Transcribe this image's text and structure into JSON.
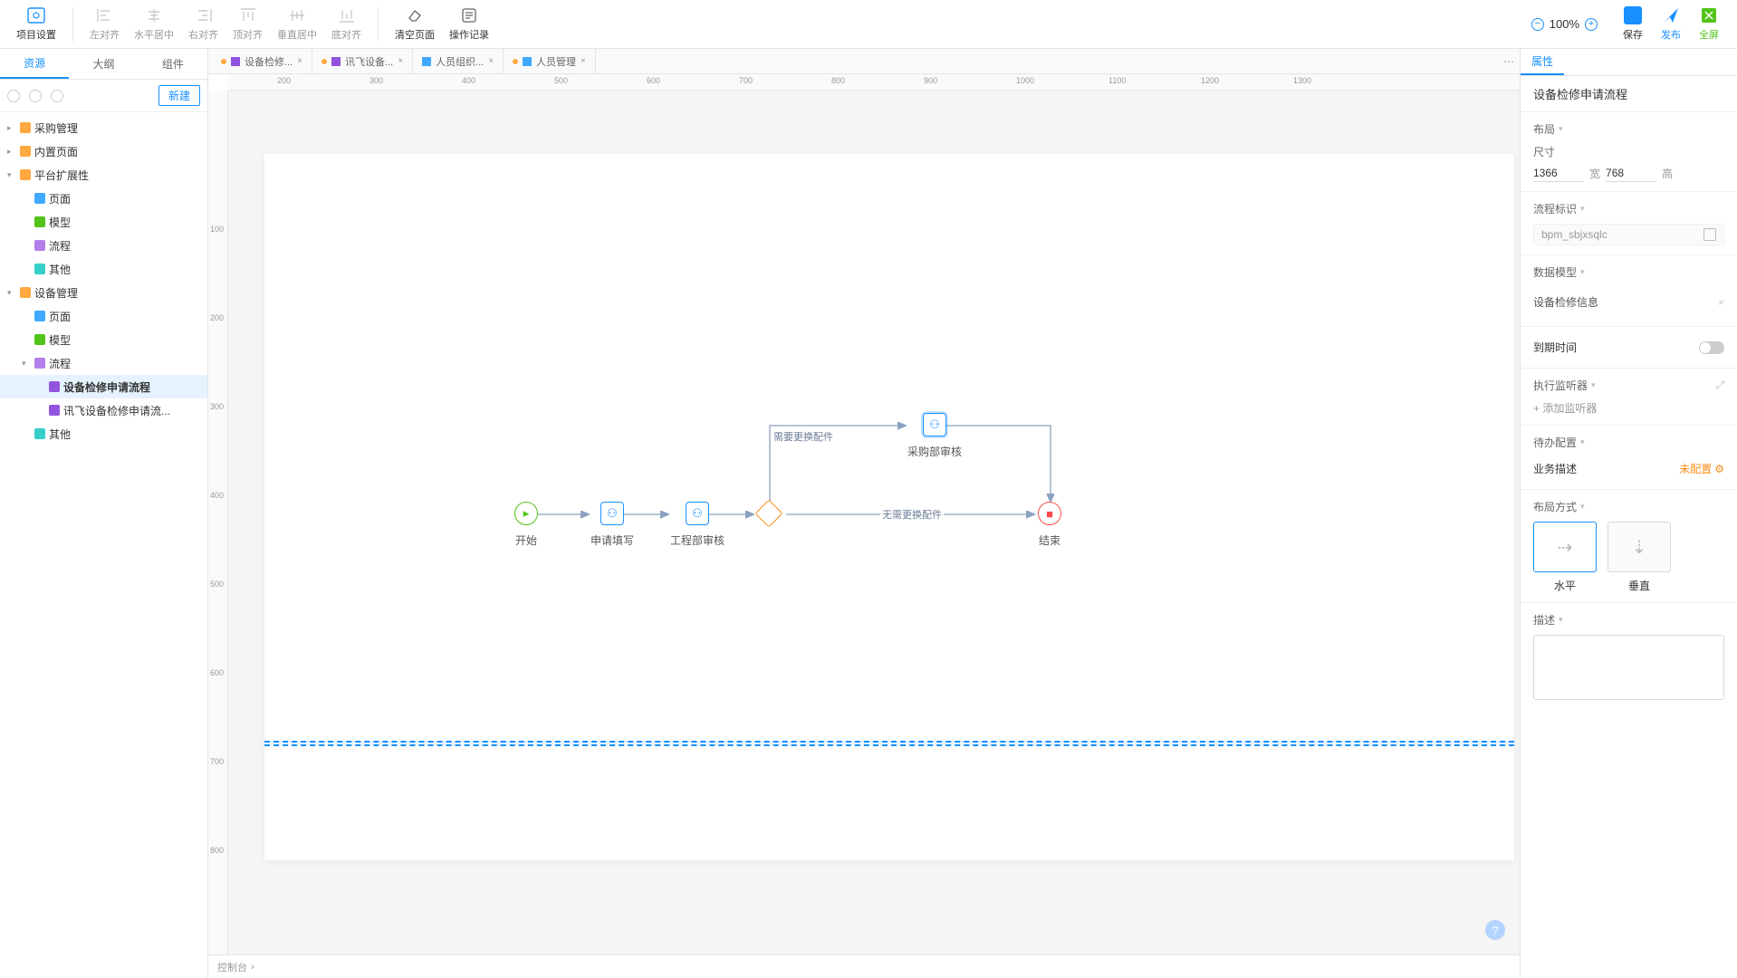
{
  "toolbar": {
    "project_settings": "项目设置",
    "align_left": "左对齐",
    "align_hcenter": "水平居中",
    "align_right": "右对齐",
    "align_top": "顶对齐",
    "align_vcenter": "垂直居中",
    "align_bottom": "底对齐",
    "clear_page": "清空页面",
    "history": "操作记录",
    "zoom": "100%",
    "save": "保存",
    "publish": "发布",
    "fullscreen": "全屏"
  },
  "left": {
    "tabs": [
      "资源",
      "大纲",
      "组件"
    ],
    "new_btn": "新建",
    "tree": [
      {
        "l": 0,
        "caret": "▸",
        "ico": "ico-cube",
        "label": "采购管理"
      },
      {
        "l": 0,
        "caret": "▸",
        "ico": "ico-cube",
        "label": "内置页面"
      },
      {
        "l": 0,
        "caret": "▾",
        "ico": "ico-cube",
        "label": "平台扩展性"
      },
      {
        "l": 1,
        "caret": "",
        "ico": "ico-blue",
        "label": "页面"
      },
      {
        "l": 1,
        "caret": "",
        "ico": "ico-green",
        "label": "模型"
      },
      {
        "l": 1,
        "caret": "",
        "ico": "ico-purple",
        "label": "流程"
      },
      {
        "l": 1,
        "caret": "",
        "ico": "ico-teal",
        "label": "其他"
      },
      {
        "l": 0,
        "caret": "▾",
        "ico": "ico-cube",
        "label": "设备管理"
      },
      {
        "l": 1,
        "caret": "",
        "ico": "ico-blue",
        "label": "页面"
      },
      {
        "l": 1,
        "caret": "",
        "ico": "ico-green",
        "label": "模型"
      },
      {
        "l": 1,
        "caret": "▾",
        "ico": "ico-purple",
        "label": "流程"
      },
      {
        "l": 2,
        "caret": "",
        "ico": "ico-flow",
        "label": "设备检修申请流程",
        "selected": true
      },
      {
        "l": 2,
        "caret": "",
        "ico": "ico-flow",
        "label": "讯飞设备检修申请流..."
      },
      {
        "l": 1,
        "caret": "",
        "ico": "ico-teal",
        "label": "其他"
      }
    ]
  },
  "tabs": [
    {
      "dirty": true,
      "ico": "fi-flow",
      "label": "设备检修..."
    },
    {
      "dirty": true,
      "ico": "fi-flow",
      "label": "讯飞设备..."
    },
    {
      "dirty": false,
      "ico": "fi-page",
      "label": "人员组织..."
    },
    {
      "dirty": true,
      "ico": "fi-page",
      "label": "人员管理"
    }
  ],
  "flow": {
    "start": "开始",
    "apply": "申请填写",
    "eng_review": "工程部审核",
    "need_replace": "需要更换配件",
    "no_replace": "无需更换配件",
    "purchase_review": "采购部审核",
    "end": "结束"
  },
  "console": "控制台",
  "right": {
    "tab": "属性",
    "title": "设备检修申请流程",
    "layout": "布局",
    "size": "尺寸",
    "width": "1366",
    "w_lbl": "宽",
    "height": "768",
    "h_lbl": "高",
    "flow_id": "流程标识",
    "flow_id_val": "bpm_sbjxsqlc",
    "data_model": "数据模型",
    "data_model_val": "设备检修信息",
    "due": "到期时间",
    "listener": "执行监听器",
    "add_listener": "+ 添加监听器",
    "todo": "待办配置",
    "biz_desc": "业务描述",
    "not_config": "未配置",
    "layout_mode": "布局方式",
    "horiz": "水平",
    "vert": "垂直",
    "desc": "描述"
  },
  "ruler_h": [
    200,
    300,
    400,
    500,
    600,
    700,
    800,
    900,
    1000,
    1100,
    1200,
    1300
  ],
  "ruler_v": [
    100,
    200,
    300,
    400,
    500,
    600,
    700,
    800
  ]
}
